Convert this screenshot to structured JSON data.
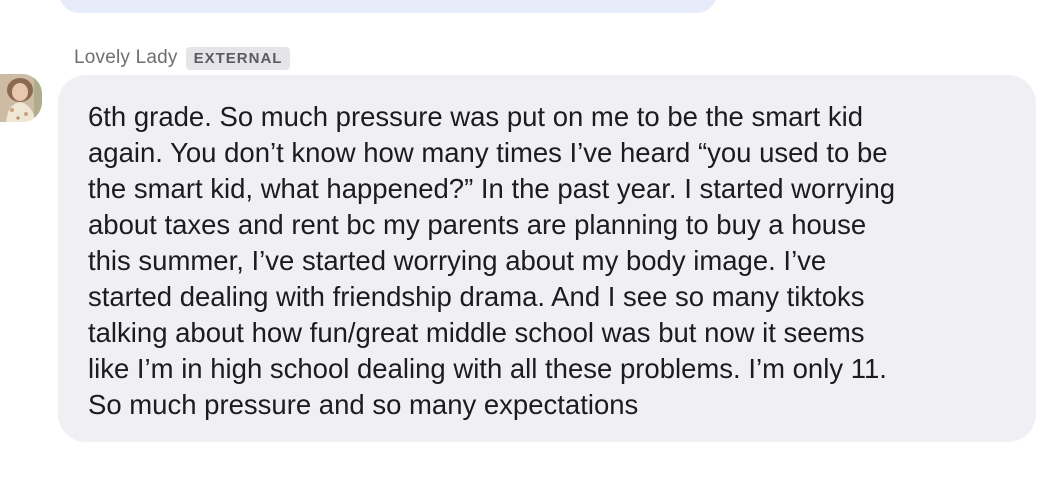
{
  "sender": {
    "name": "Lovely Lady",
    "badge": "EXTERNAL"
  },
  "message": {
    "text": "6th grade. So much pressure was put on me to be the smart kid\nagain. You don’t know how many times I’ve heard “you used to be\nthe smart kid, what happened?” In the past year. I started worrying\nabout taxes and rent bc my parents are planning to buy a house\nthis summer, I’ve started worrying about my body image. I’ve\nstarted dealing with friendship drama. And I see so many tiktoks\ntalking about how fun/great middle school was but now it seems\nlike I’m in high school dealing with all these problems. I’m only 11.\nSo much pressure and so many expectations"
  },
  "colors": {
    "bubble_background": "#efeff4",
    "previous_bubble_background": "#e6ecfa",
    "badge_background": "#e4e4e9",
    "text": "#1c1c1e",
    "sender_name": "#6e6e73"
  }
}
